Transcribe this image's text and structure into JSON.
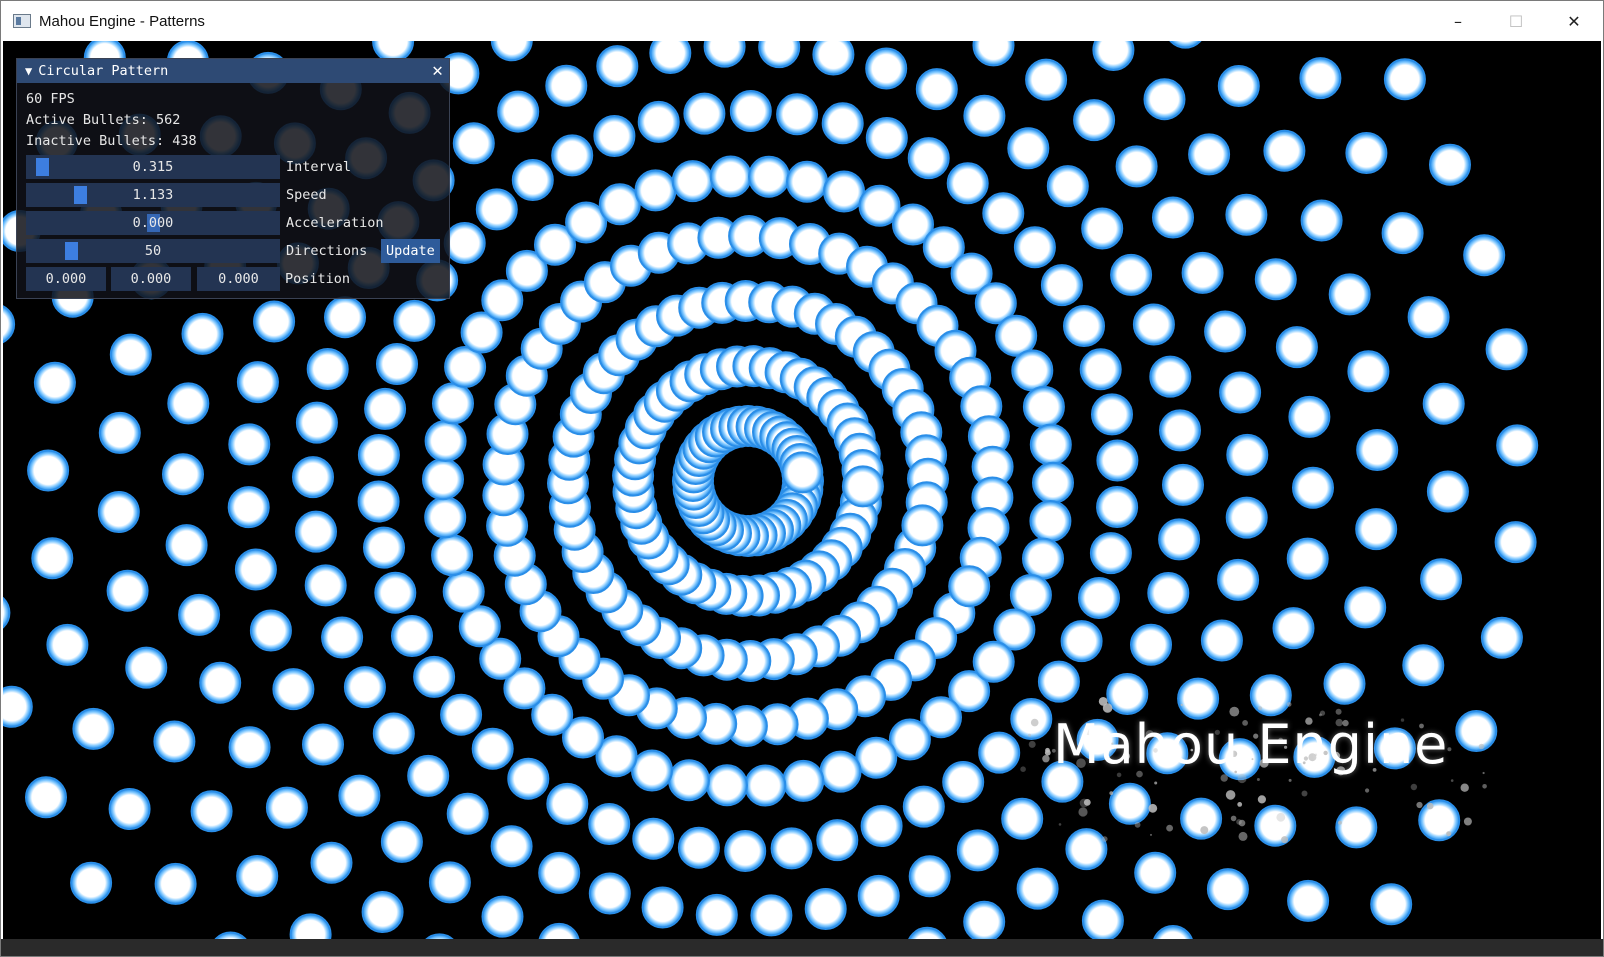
{
  "window": {
    "title": "Mahou Engine - Patterns",
    "minimize": "–",
    "maximize": "☐",
    "close": "✕"
  },
  "logo": {
    "text": "Mahou Engine"
  },
  "panel": {
    "title": "Circular Pattern",
    "collapse_glyph": "▼",
    "close_glyph": "✕",
    "fps": "60 FPS",
    "active_bullets": "Active Bullets: 562",
    "inactive_bullets": "Inactive Bullets: 438",
    "interval": {
      "label": "Interval",
      "value": "0.315",
      "fraction": 0.04
    },
    "speed": {
      "label": "Speed",
      "value": "1.133",
      "fraction": 0.2
    },
    "acceleration": {
      "label": "Acceleration",
      "value": "0.000",
      "fraction": 0.5
    },
    "directions": {
      "label": "Directions",
      "value": "50",
      "fraction": 0.16,
      "button": "Update"
    },
    "position": {
      "label": "Position",
      "x": "0.000",
      "y": "0.000",
      "z": "0.000"
    }
  },
  "colors": {
    "bullet_fill": "#ffffff",
    "bullet_rim": "#2a8ee8",
    "panel_header": "#2e4a74",
    "slider_grab": "#3d7ee0",
    "viewport_bg": "#000000"
  }
}
